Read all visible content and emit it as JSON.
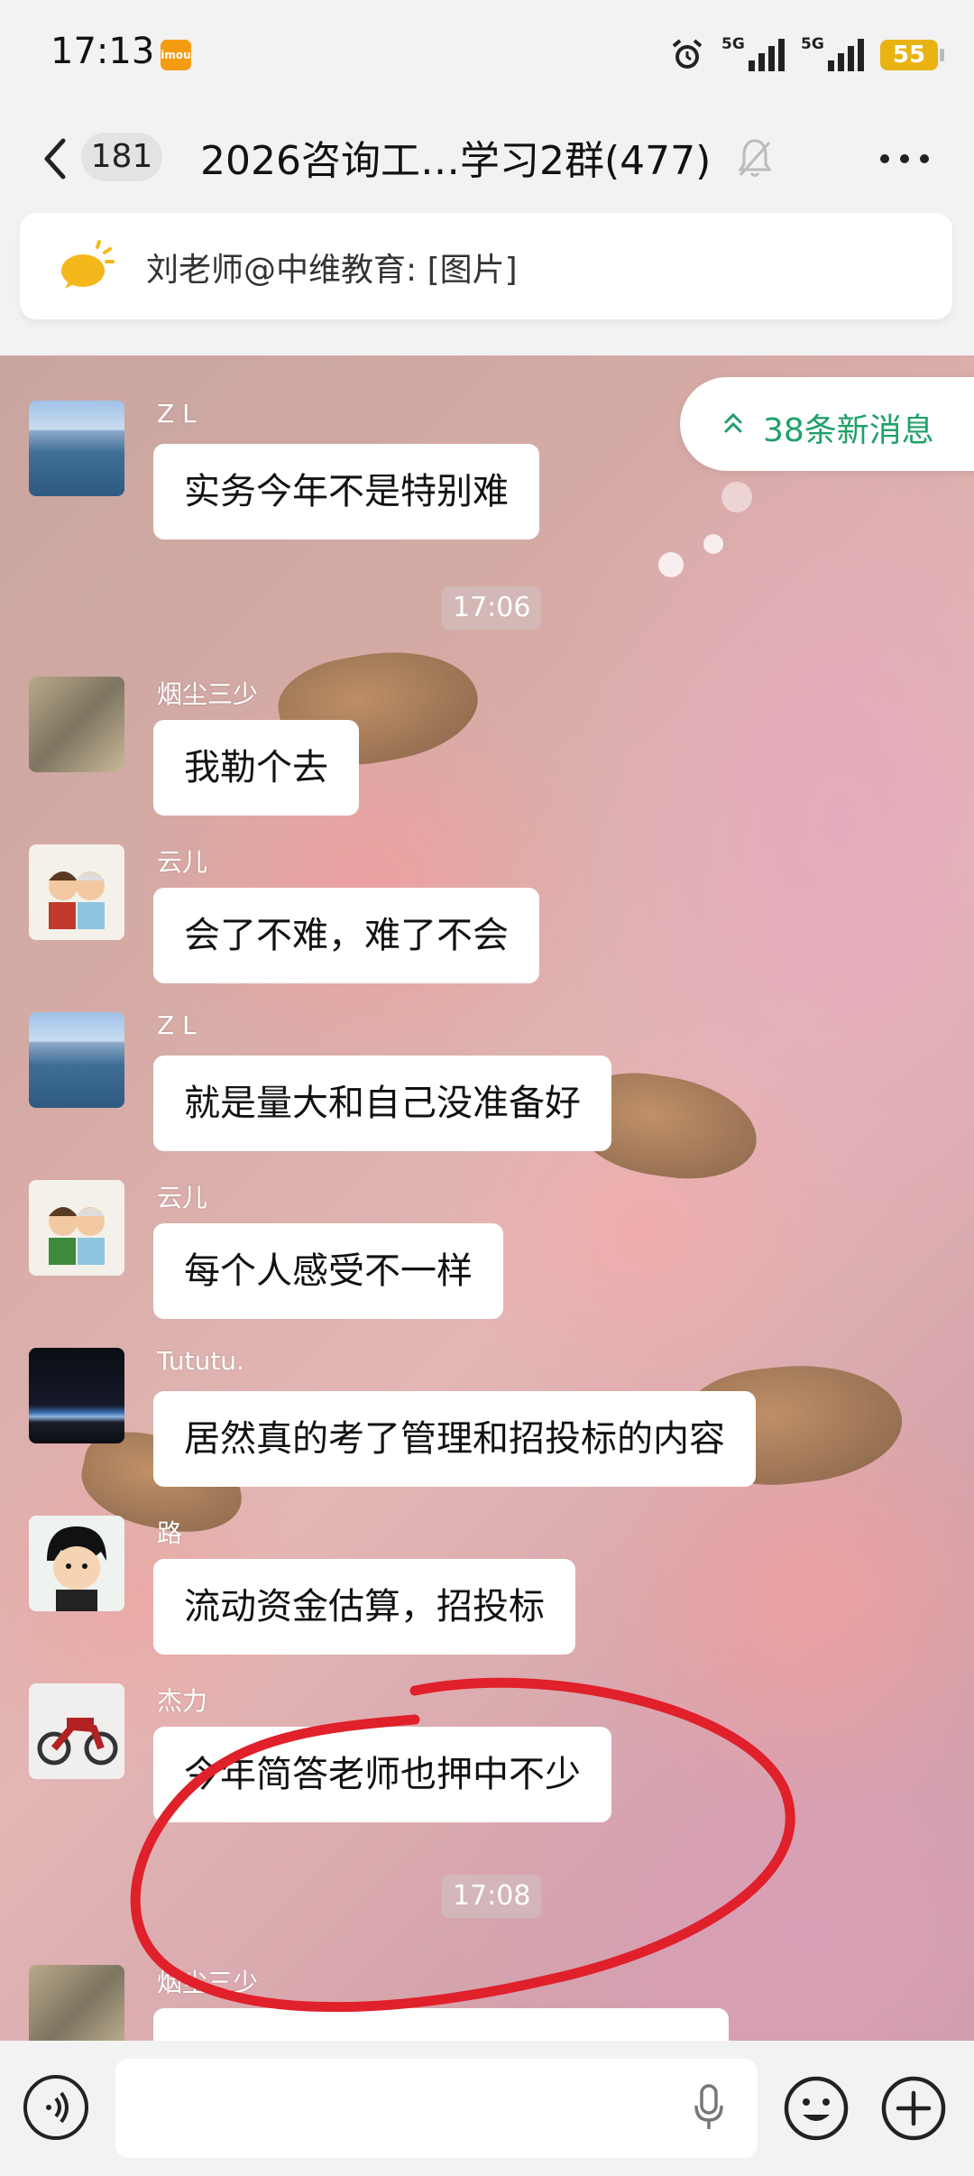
{
  "status_bar": {
    "time": "17:13",
    "app_badge": "imou",
    "signal1_label": "5G",
    "signal2_label": "5G",
    "battery": "55"
  },
  "header": {
    "unread_count": "181",
    "title": "2026咨询工…学习2群(477)"
  },
  "pinned": {
    "text": "刘老师@中维教育: [图片]"
  },
  "new_messages": {
    "label": "38条新消息"
  },
  "messages": [
    {
      "sender": "Z  L",
      "text": "实务今年不是特别难"
    },
    {
      "sender": "烟尘三少",
      "text": "我勒个去"
    },
    {
      "sender": "云儿",
      "text": "会了不难，难了不会"
    },
    {
      "sender": "Z  L",
      "text": "就是量大和自己没准备好"
    },
    {
      "sender": "云儿",
      "text": "每个人感受不一样"
    },
    {
      "sender": "Tututu.",
      "text": "居然真的考了管理和招投标的内容"
    },
    {
      "sender": "路",
      "text": "流动资金估算，招投标"
    },
    {
      "sender": "杰力",
      "text": "今年简答老师也押中不少"
    },
    {
      "sender": "烟尘三少",
      "text": ""
    }
  ],
  "timestamps": [
    "17:06",
    "17:08"
  ],
  "colors": {
    "accent_green": "#20a06a",
    "annotation_red": "#e0202a",
    "battery_yellow": "#e9b312"
  }
}
